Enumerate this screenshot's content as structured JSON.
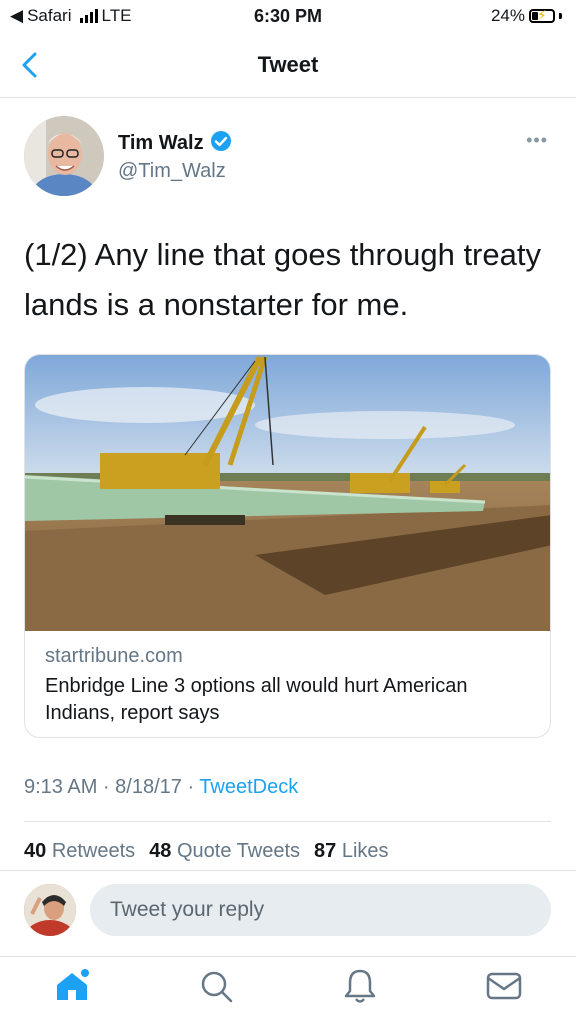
{
  "status_bar": {
    "carrier_back": "Safari",
    "network": "LTE",
    "time": "6:30 PM",
    "battery": "24%"
  },
  "header": {
    "title": "Tweet",
    "back_icon": "chevron-left-icon"
  },
  "tweet": {
    "author_name": "Tim Walz",
    "author_handle": "@Tim_Walz",
    "verified_icon": "verified-badge-icon",
    "more_label": "•••",
    "text": "(1/2) Any line that goes through treaty lands is a nonstarter for me.",
    "card": {
      "domain": "startribune.com",
      "title": "Enbridge Line 3 options all would hurt American Indians, report says"
    },
    "timestamp": "9:13 AM · 8/18/17 · ",
    "source": "TweetDeck",
    "stats": {
      "retweets_count": "40",
      "retweets_label": "Retweets",
      "quotes_count": "48",
      "quotes_label": "Quote Tweets",
      "likes_count": "87",
      "likes_label": "Likes"
    }
  },
  "reply": {
    "placeholder": "Tweet your reply"
  },
  "tabbar": {
    "items": [
      "home-icon",
      "search-icon",
      "notifications-icon",
      "messages-icon"
    ]
  },
  "colors": {
    "accent": "#1da1f2",
    "secondary_text": "#657786",
    "border": "#dfe3e6"
  }
}
